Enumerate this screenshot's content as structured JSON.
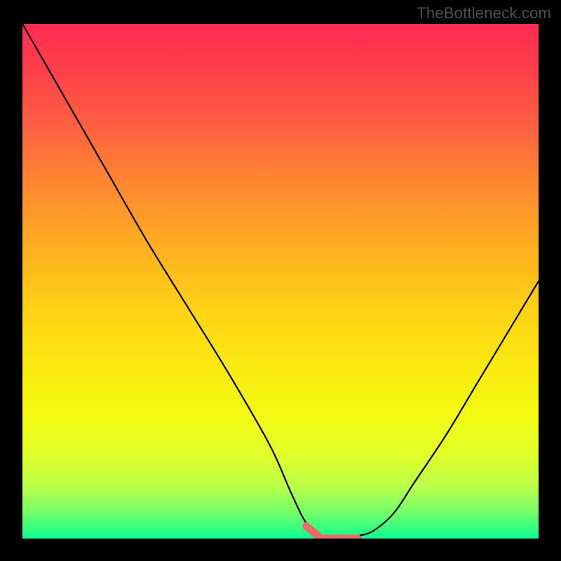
{
  "watermark": "TheBottleneck.com",
  "chart_data": {
    "type": "line",
    "title": "",
    "xlabel": "",
    "ylabel": "",
    "xlim": [
      0,
      100
    ],
    "ylim": [
      0,
      100
    ],
    "series": [
      {
        "name": "bottleneck-curve",
        "x": [
          0,
          8,
          16,
          24,
          32,
          40,
          48,
          52,
          55,
          58,
          60,
          63,
          65,
          68,
          72,
          76,
          82,
          88,
          94,
          100
        ],
        "values": [
          100,
          86,
          72,
          58,
          45,
          32,
          18,
          9,
          3,
          0.5,
          0,
          0,
          0.5,
          1.5,
          5,
          11,
          20,
          30,
          40,
          50
        ]
      }
    ],
    "annotations": [
      {
        "name": "optimal-region",
        "type": "span",
        "x_start": 55,
        "x_end": 65,
        "color": "#e86a62"
      }
    ],
    "background_gradient": {
      "top": "#ff2a53",
      "bottom": "#07ff92"
    }
  }
}
